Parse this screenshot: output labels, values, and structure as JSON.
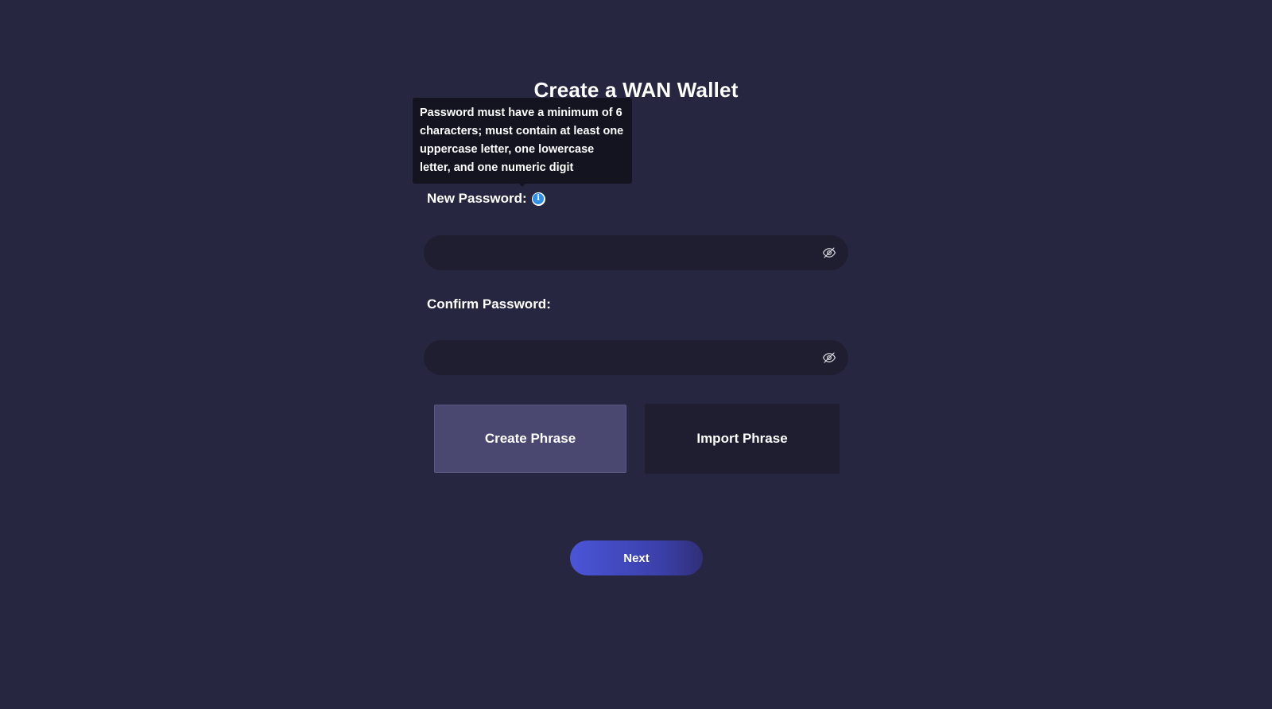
{
  "page": {
    "title": "Create a WAN Wallet"
  },
  "tooltip": {
    "text": "Password must have a minimum of 6 characters; must contain at least one uppercase letter, one lowercase letter, and one numeric digit"
  },
  "form": {
    "new_password_label": "New Password:",
    "new_password_value": "",
    "new_password_placeholder": "",
    "confirm_password_label": "Confirm Password:",
    "confirm_password_value": "",
    "confirm_password_placeholder": "",
    "info_icon_glyph": "i"
  },
  "phrase_options": {
    "create_label": "Create Phrase",
    "import_label": "Import Phrase",
    "selected": "Create Phrase"
  },
  "actions": {
    "next_label": "Next"
  },
  "icons": {
    "info": "info-icon",
    "password_visibility": "eye-slash-icon"
  },
  "colors": {
    "background": "#272640",
    "input_background": "#1f1e31",
    "selected_option": "#4a4870",
    "accent": "#4b55d8",
    "info": "#2f8fe6"
  }
}
